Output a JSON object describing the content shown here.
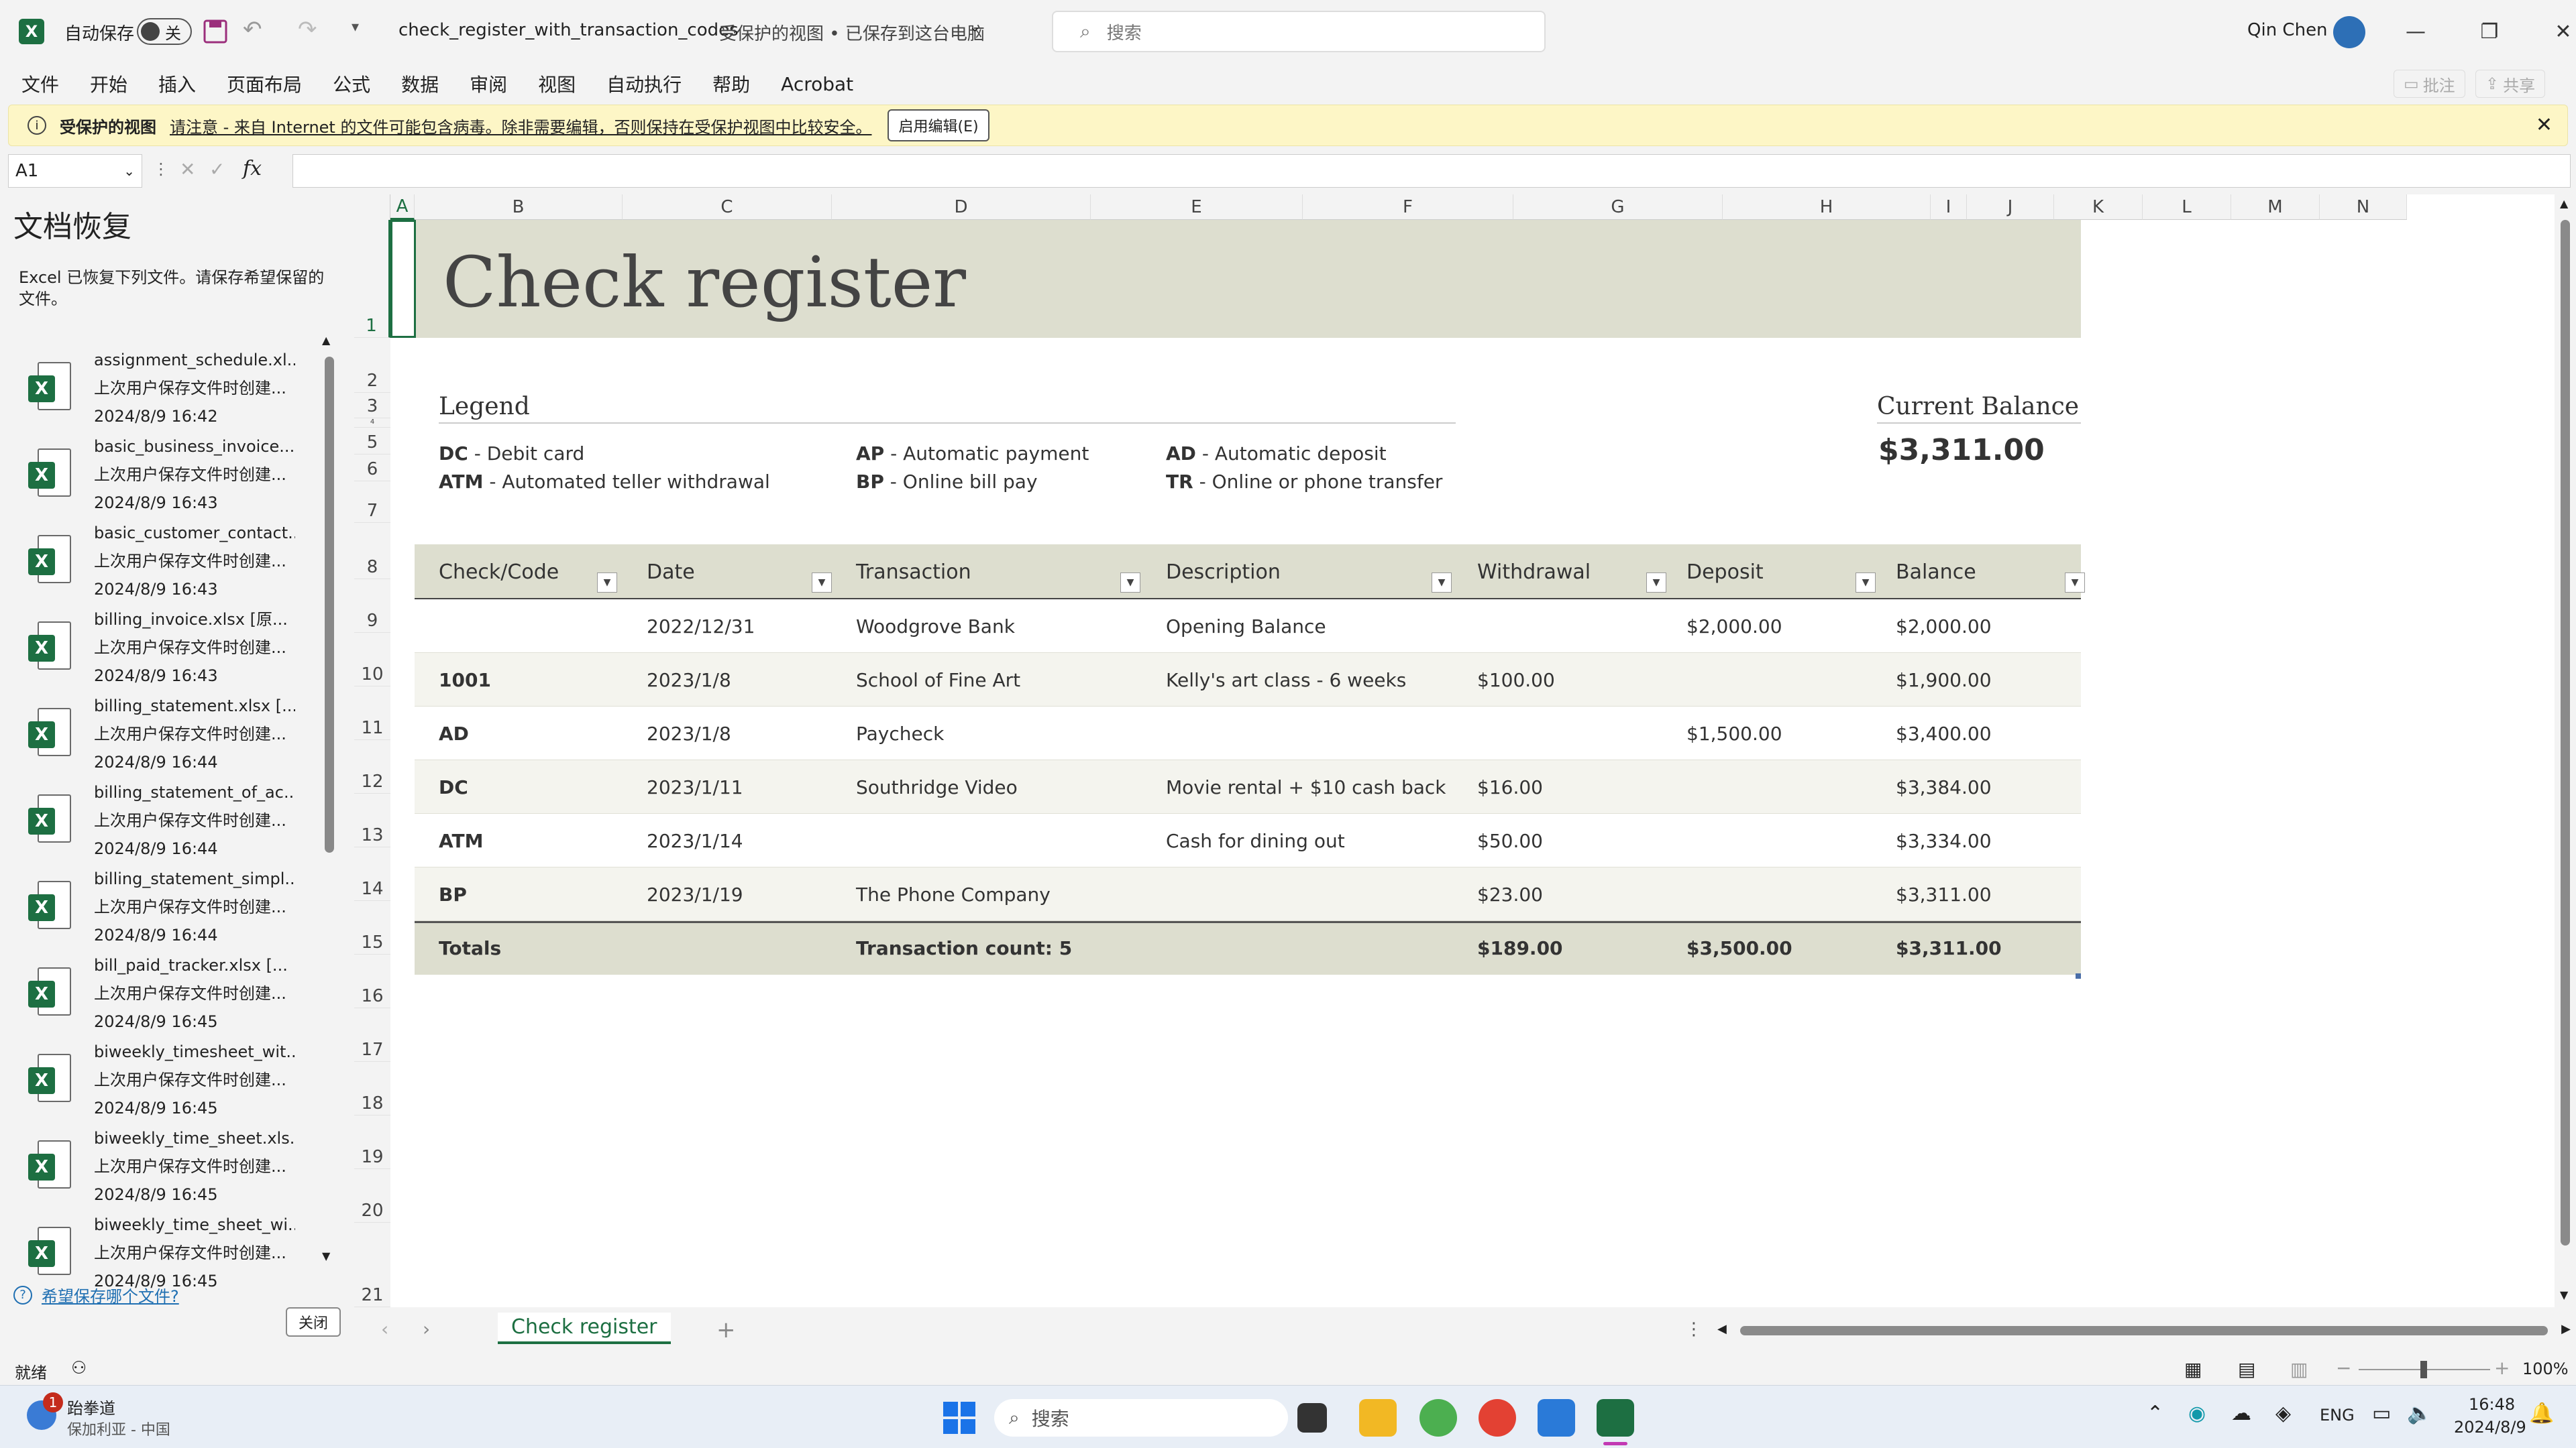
{
  "titlebar": {
    "autosave_label": "自动保存",
    "autosave_state": "关",
    "filename": "check_register_with_transaction_codes",
    "status": "受保护的视图 • 已保存到这台电脑",
    "search_placeholder": "搜索",
    "user": "Qin Chen"
  },
  "menu": {
    "items": [
      "文件",
      "开始",
      "插入",
      "页面布局",
      "公式",
      "数据",
      "审阅",
      "视图",
      "自动执行",
      "帮助",
      "Acrobat"
    ],
    "comments": "批注",
    "share": "共享"
  },
  "protected": {
    "title": "受保护的视图",
    "message": "请注意 - 来自 Internet 的文件可能包含病毒。除非需要编辑，否则保持在受保护视图中比较安全。",
    "button": "启用编辑(E)"
  },
  "formula": {
    "cell": "A1",
    "fx": "fx",
    "value": ""
  },
  "recovery": {
    "title": "文档恢复",
    "description": "Excel 已恢复下列文件。请保存希望保留的文件。",
    "files": [
      {
        "name": "assignment_schedule.xl...",
        "note": "上次用户保存文件时创建...",
        "time": "2024/8/9 16:42"
      },
      {
        "name": "basic_business_invoice....",
        "note": "上次用户保存文件时创建...",
        "time": "2024/8/9 16:43"
      },
      {
        "name": "basic_customer_contact...",
        "note": "上次用户保存文件时创建...",
        "time": "2024/8/9 16:43"
      },
      {
        "name": "billing_invoice.xlsx  [原...",
        "note": "上次用户保存文件时创建...",
        "time": "2024/8/9 16:43"
      },
      {
        "name": "billing_statement.xlsx  [...",
        "note": "上次用户保存文件时创建...",
        "time": "2024/8/9 16:44"
      },
      {
        "name": "billing_statement_of_ac...",
        "note": "上次用户保存文件时创建...",
        "time": "2024/8/9 16:44"
      },
      {
        "name": "billing_statement_simpl...",
        "note": "上次用户保存文件时创建...",
        "time": "2024/8/9 16:44"
      },
      {
        "name": "bill_paid_tracker.xlsx  [...",
        "note": "上次用户保存文件时创建...",
        "time": "2024/8/9 16:45"
      },
      {
        "name": "biweekly_timesheet_wit...",
        "note": "上次用户保存文件时创建...",
        "time": "2024/8/9 16:45"
      },
      {
        "name": "biweekly_time_sheet.xls...",
        "note": "上次用户保存文件时创建...",
        "time": "2024/8/9 16:45"
      },
      {
        "name": "biweekly_time_sheet_wi...",
        "note": "上次用户保存文件时创建...",
        "time": "2024/8/9 16:45"
      }
    ],
    "which_link": "希望保存哪个文件?",
    "close_button": "关闭"
  },
  "columns": [
    "A",
    "B",
    "C",
    "D",
    "E",
    "F",
    "G",
    "H",
    "I",
    "J",
    "K",
    "L",
    "M",
    "N"
  ],
  "rows": [
    "1",
    "2",
    "3",
    "4",
    "5",
    "6",
    "7",
    "8",
    "9",
    "10",
    "11",
    "12",
    "13",
    "14",
    "15",
    "16",
    "17",
    "18",
    "19",
    "20",
    "21"
  ],
  "sheet": {
    "title": "Check register",
    "legend_title": "Legend",
    "legend": [
      {
        "code": "DC",
        "desc": "Debit card"
      },
      {
        "code": "ATM",
        "desc": "Automated teller withdrawal"
      },
      {
        "code": "AP",
        "desc": "Automatic payment"
      },
      {
        "code": "BP",
        "desc": "Online bill pay"
      },
      {
        "code": "AD",
        "desc": "Automatic deposit"
      },
      {
        "code": "TR",
        "desc": "Online or phone transfer"
      }
    ],
    "balance_label": "Current Balance",
    "balance_value": "$3,311.00",
    "headers": [
      "Check/Code",
      "Date",
      "Transaction",
      "Description",
      "Withdrawal",
      "Deposit",
      "Balance"
    ],
    "rows": [
      [
        "",
        "2022/12/31",
        "Woodgrove Bank",
        "Opening Balance",
        "",
        "$2,000.00",
        "$2,000.00"
      ],
      [
        "1001",
        "2023/1/8",
        "School of Fine Art",
        "Kelly's art class - 6 weeks",
        "$100.00",
        "",
        "$1,900.00"
      ],
      [
        "AD",
        "2023/1/8",
        "Paycheck",
        "",
        "",
        "$1,500.00",
        "$3,400.00"
      ],
      [
        "DC",
        "2023/1/11",
        "Southridge Video",
        "Movie rental + $10 cash back",
        "$16.00",
        "",
        "$3,384.00"
      ],
      [
        "ATM",
        "2023/1/14",
        "",
        "Cash for dining out",
        "$50.00",
        "",
        "$3,334.00"
      ],
      [
        "BP",
        "2023/1/19",
        "The Phone Company",
        "",
        "$23.00",
        "",
        "$3,311.00"
      ]
    ],
    "totals": [
      "Totals",
      "",
      "Transaction count: 5",
      "",
      "$189.00",
      "$3,500.00",
      "$3,311.00"
    ]
  },
  "tabs": {
    "active": "Check register"
  },
  "status": {
    "ready": "就绪",
    "zoom": "100%"
  },
  "taskbar": {
    "app_name": "跆拳道",
    "app_sub": "保加利亚 - 中国",
    "badge": "1",
    "search": "搜索",
    "lang": "ENG",
    "time": "16:48",
    "date": "2024/8/9"
  },
  "colors": {
    "band": "#dddecf",
    "accent": "#1d6f42"
  }
}
